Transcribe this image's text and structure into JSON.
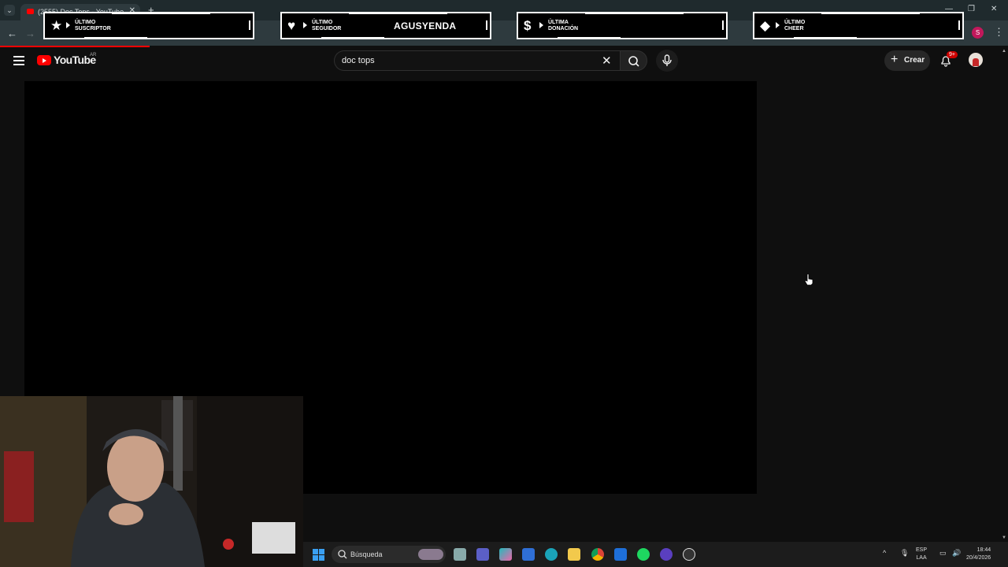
{
  "browser": {
    "tab_title": "(2555) Doc Tops - YouTube",
    "tab_close": "✕",
    "new_tab": "+",
    "profile_letter": "S",
    "back": "←",
    "forward": "→"
  },
  "overlay": {
    "alerts": [
      {
        "icon": "star-icon",
        "glyph": "★",
        "line1": "ÚLTIMO",
        "line2": "SUSCRIPTOR",
        "value": ""
      },
      {
        "icon": "heart-icon",
        "glyph": "♥",
        "line1": "ÚLTIMO",
        "line2": "SEGUIDOR",
        "value": "AGUSYENDA"
      },
      {
        "icon": "dollar-icon",
        "glyph": "$",
        "line1": "ÚLTIMA",
        "line2": "DONACIÓN",
        "value": ""
      },
      {
        "icon": "diamond-icon",
        "glyph": "◆",
        "line1": "ÚLTIMO",
        "line2": "CHEER",
        "value": ""
      }
    ]
  },
  "youtube": {
    "logo_text": "YouTube",
    "country_code": "AR",
    "search_query": "doc tops",
    "create_label": "Crear",
    "notifications_badge": "9+",
    "accent": "#ff0000"
  },
  "taskbar": {
    "search_label": "Búsqueda",
    "lang_line1": "ESP",
    "lang_line2": "LAA",
    "time": "18:44",
    "date": "20/4/2026",
    "tray_caret": "^",
    "apps": [
      "file-explorer-icon",
      "teams-icon",
      "copilot-icon",
      "store-icon",
      "edge-icon",
      "folder-icon",
      "chrome-icon",
      "mail-icon",
      "spotify-icon",
      "app-icon",
      "obs-icon"
    ]
  }
}
